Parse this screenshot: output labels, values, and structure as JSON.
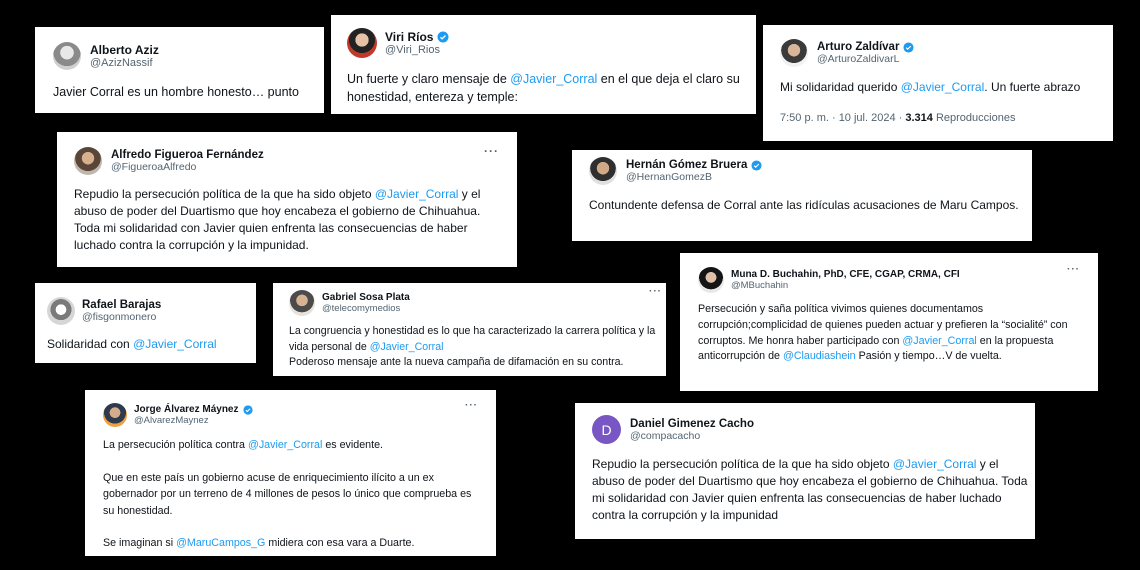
{
  "more_label": "···",
  "tweets": [
    {
      "name": "Alberto Aziz",
      "handle": "@AzizNassif",
      "verified": false,
      "text": "Javier Corral es un hombre honesto… punto"
    },
    {
      "name": "Viri Ríos",
      "handle": "@Viri_Rios",
      "verified": true,
      "mention": "@Javier_Corral",
      "pre": "Un fuerte y claro mensaje de ",
      "post": " en el que deja el claro su honestidad, entereza y temple:"
    },
    {
      "name": "Arturo Zaldívar",
      "handle": "@ArturoZaldivarL",
      "verified": true,
      "mention": "@Javier_Corral",
      "pre": "Mi solidaridad querido ",
      "post": ". Un fuerte abrazo",
      "time": "7:50 p. m. · 10 jul. 2024 · ",
      "views": "3.314",
      "views_label": " Reproducciones"
    },
    {
      "name": "Alfredo Figueroa Fernández",
      "handle": "@FigueroaAlfredo",
      "verified": false,
      "mention": "@Javier_Corral",
      "pre": "Repudio la persecución política de la que ha sido objeto ",
      "post": "  y el abuso de poder del Duartismo que hoy encabeza el gobierno de Chihuahua. Toda mi solidaridad con Javier quien enfrenta las consecuencias de haber luchado contra la corrupción y la impunidad."
    },
    {
      "name": "Hernán Gómez Bruera",
      "handle": "@HernanGomezB",
      "verified": true,
      "text": "Contundente defensa de Corral ante las ridículas acusaciones de Maru Campos."
    },
    {
      "name": "Rafael Barajas",
      "handle": "@fisgonmonero",
      "verified": false,
      "mention": "@Javier_Corral",
      "pre": "Solidaridad con ",
      "post": ""
    },
    {
      "name": "Gabriel Sosa Plata",
      "handle": "@telecomymedios",
      "verified": false,
      "mention": "@Javier_Corral",
      "pre": "La congruencia y honestidad es lo que ha caracterizado la carrera política y la vida personal de ",
      "post": "",
      "line2": "Poderoso mensaje ante la nueva campaña de difamación en su contra."
    },
    {
      "name": "Muna D. Buchahin, PhD, CFE, CGAP, CRMA, CFI",
      "handle": "@MBuchahin",
      "verified": false,
      "pre": "Persecución y saña política vivimos quienes documentamos corrupción;complicidad de quienes pueden actuar y prefieren la “socialité” con corruptos. Me honra haber participado con ",
      "mention": "@Javier_Corral",
      "mid": " en la propuesta anticorrupción de ",
      "mention2": "@Claudiashein",
      "post": "  Pasión y tiempo…V de vuelta."
    },
    {
      "name": "Jorge Álvarez Máynez",
      "handle": "@AlvarezMaynez",
      "verified": true,
      "pre": "La persecución política contra ",
      "mention": "@Javier_Corral",
      "post": " es evidente.",
      "p2": "Que en este país un gobierno acuse de enriquecimiento ilícito a un ex gobernador por un terreno de 4 millones de pesos lo único que comprueba es su honestidad.",
      "p3pre": "Se imaginan si ",
      "mention2": "@MaruCampos_G",
      "p3post": " midiera con esa vara a Duarte."
    },
    {
      "name": "Daniel Gimenez Cacho",
      "handle": "@compacacho",
      "verified": false,
      "avatar_letter": "D",
      "mention": "@Javier_Corral",
      "pre": "Repudio la persecución política de la que ha sido objeto ",
      "post": "  y el abuso de poder del Duartismo que hoy encabeza el gobierno de Chihuahua. Toda mi solidaridad con Javier quien enfrenta las consecuencias de haber luchado contra la corrupción y la impunidad"
    }
  ]
}
